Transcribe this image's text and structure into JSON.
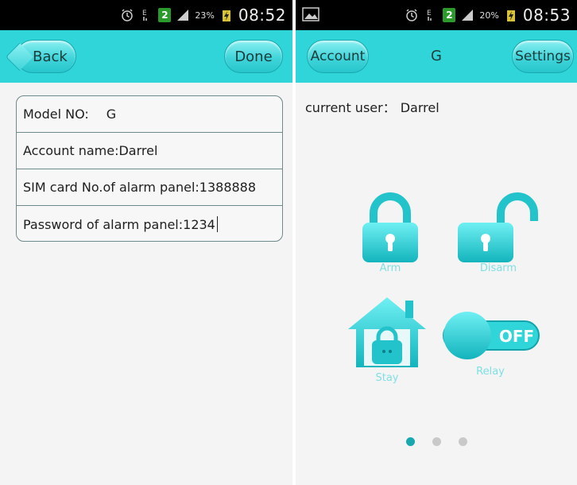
{
  "left": {
    "status": {
      "badge": "2",
      "signal_pct": "23%",
      "time": "08:52"
    },
    "header": {
      "back_label": "Back",
      "done_label": "Done"
    },
    "form": {
      "model_label": "Model NO:",
      "model_value": "G",
      "account_label": "Account name:",
      "account_value": "Darrel",
      "sim_label": "SIM card No.of alarm panel:",
      "sim_value": "1388888",
      "password_label": "Password of alarm panel:",
      "password_value": "1234"
    }
  },
  "right": {
    "status": {
      "badge": "2",
      "signal_pct": "20%",
      "time": "08:53"
    },
    "header": {
      "account_label": "Account",
      "title": "G",
      "settings_label": "Settings"
    },
    "current_user_label": "current user：",
    "current_user_value": "Darrel",
    "controls": {
      "arm_label": "Arm",
      "disarm_label": "Disarm",
      "stay_label": "Stay",
      "relay_label": "Relay",
      "relay_state": "OFF"
    },
    "pager": {
      "pages": 3,
      "active": 1
    }
  },
  "colors": {
    "accent": "#2fd5d8",
    "accent_dark": "#17a8b0",
    "status_bar": "#000000"
  }
}
